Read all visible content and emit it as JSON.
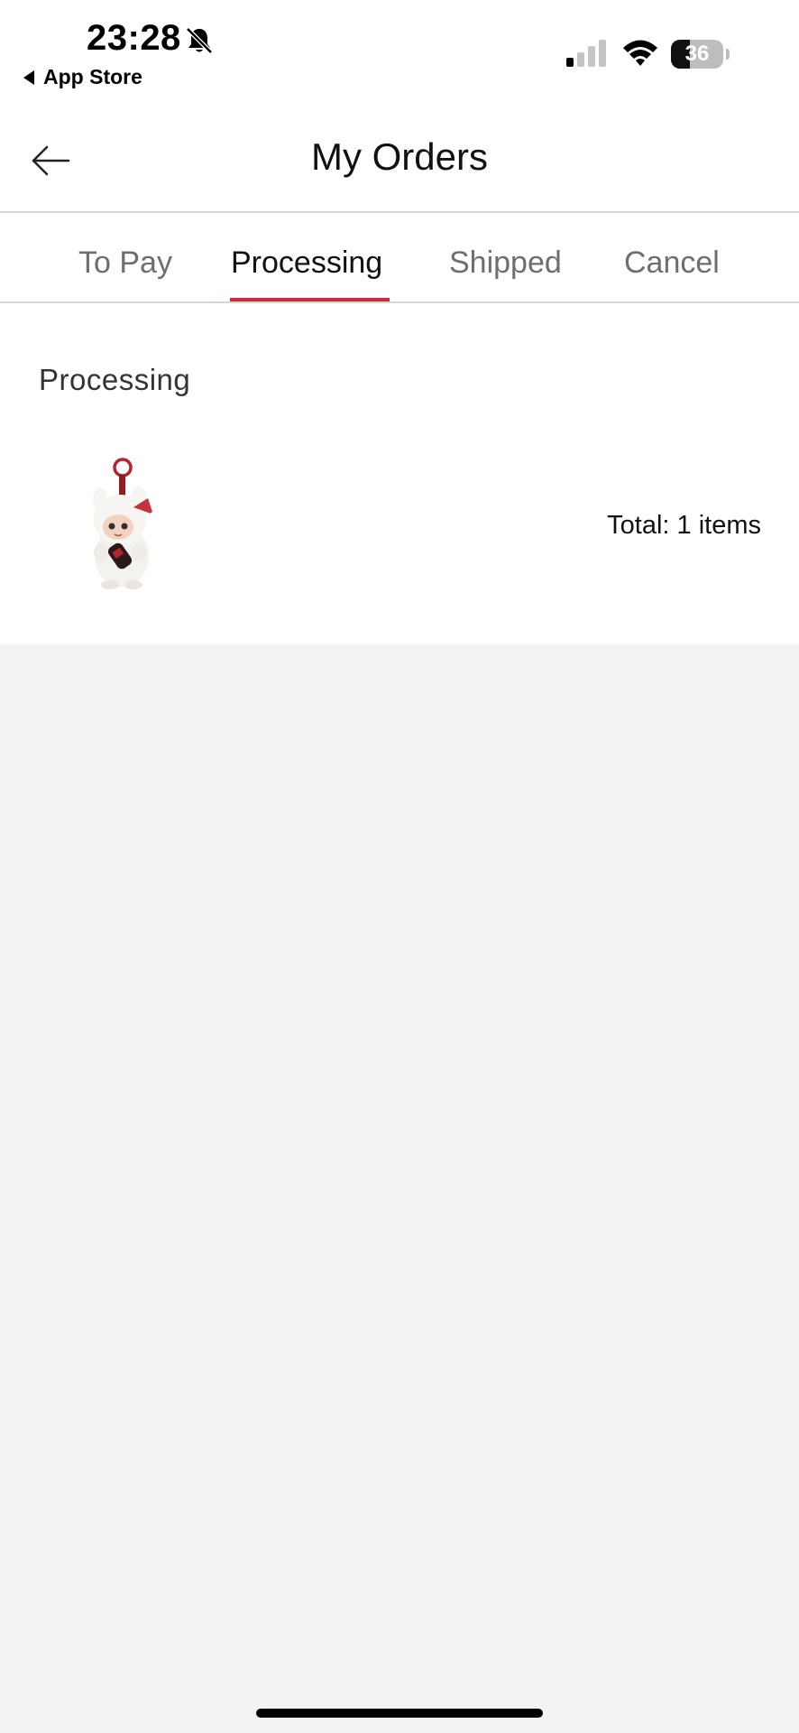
{
  "status_bar": {
    "time": "23:28",
    "back_app": "App Store",
    "battery_percent": 36,
    "battery_label": "36"
  },
  "header": {
    "title": "My Orders"
  },
  "tabs": [
    {
      "label": "To Pay",
      "active": false
    },
    {
      "label": "Processing",
      "active": true
    },
    {
      "label": "Shipped",
      "active": false
    },
    {
      "label": "Cancel",
      "active": false
    }
  ],
  "order": {
    "status": "Processing",
    "total": "Total: 1 items",
    "thumbnail": "keychain-figure-thumbnail"
  },
  "colors": {
    "accent": "#c8303a",
    "background": "#f3f3f3"
  }
}
